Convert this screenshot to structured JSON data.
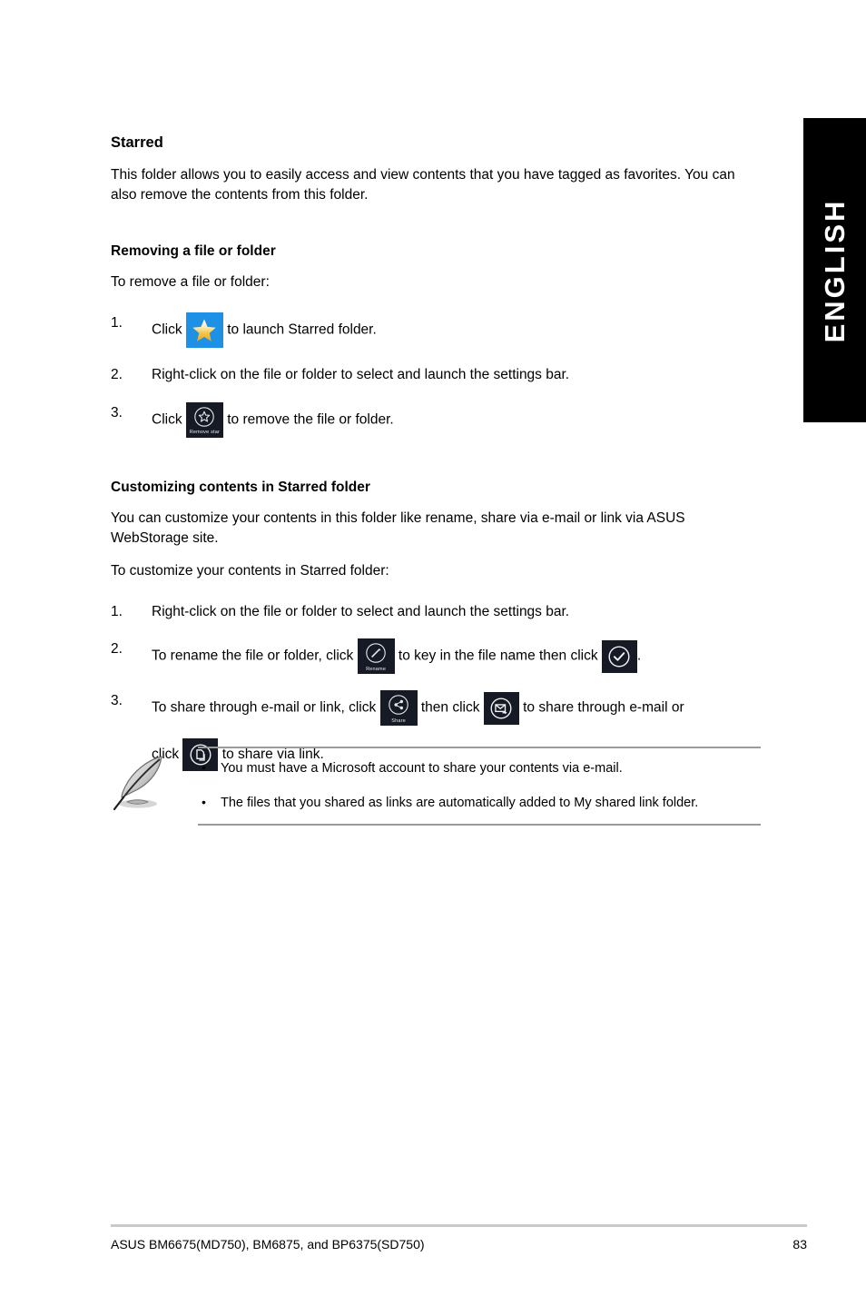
{
  "side_tab": {
    "label": "ENGLISH"
  },
  "section": {
    "title": "Starred",
    "intro": "This folder allows you to easily access and view contents that you have tagged as favorites. You can also remove the contents from this folder."
  },
  "removing": {
    "title": "Removing a file or folder",
    "lead": "To remove a file or folder:",
    "steps": [
      {
        "num": "1.",
        "before": "Click",
        "icon": "starred-folder-icon",
        "after": "to launch Starred folder."
      },
      {
        "num": "2.",
        "before": "Right-click on the file or folder to select and launch the settings bar.",
        "icon": "",
        "after": ""
      },
      {
        "num": "3.",
        "before": "Click",
        "icon": "remove-star-icon",
        "after": "to remove the file or folder."
      }
    ]
  },
  "customizing": {
    "title": "Customizing contents in Starred folder",
    "intro": "You can customize your contents in this folder like rename, share via e-mail or link via ASUS WebStorage site.",
    "lead": "To customize your contents in Starred folder:",
    "steps": [
      {
        "num": "1.",
        "text": "Right-click on the file or folder to select and launch the settings bar."
      },
      {
        "num": "2.",
        "t1": "To rename the file or folder, click",
        "t2": "to key in the file name then click",
        "t3": "."
      },
      {
        "num": "3.",
        "t1": "To share through e-mail or link, click",
        "t2": "then click",
        "t3": "to share through e-mail or",
        "t4": "click",
        "t5": "to share via link."
      }
    ]
  },
  "icons": {
    "starred_folder": {
      "name": "starred-folder-icon",
      "tile_color": "#1e90e6",
      "star_color": "#f0b832"
    },
    "remove_star": {
      "name": "remove-star-icon",
      "label": "Remove star",
      "tile_color": "#161a24"
    },
    "rename": {
      "name": "rename-icon",
      "label": "Rename",
      "tile_color": "#161a24"
    },
    "confirm": {
      "name": "confirm-check-icon",
      "tile_color": "#0a0a0a"
    },
    "share": {
      "name": "share-icon",
      "label": "Share",
      "tile_color": "#161a24"
    },
    "share_email": {
      "name": "share-email-icon",
      "tile_color": "#161a24"
    },
    "share_link": {
      "name": "share-link-icon",
      "tile_color": "#161a24"
    },
    "note_pen": {
      "name": "note-pen-icon"
    }
  },
  "note": {
    "bullet": "•",
    "items": [
      "You must have a Microsoft account to share your contents via e-mail.",
      "The files that you shared as links are automatically added to My shared link folder."
    ]
  },
  "footer": {
    "left": "ASUS BM6675(MD750), BM6875, and BP6375(SD750)",
    "page": "83"
  }
}
